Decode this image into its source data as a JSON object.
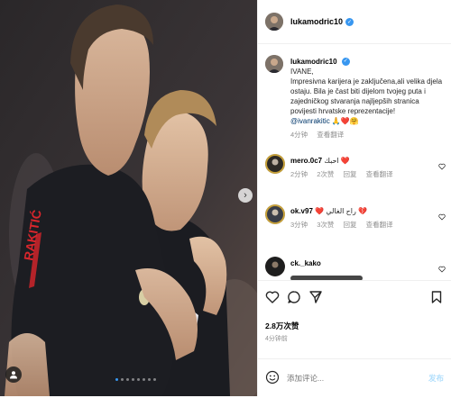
{
  "post": {
    "username": "lukamodric10",
    "verified": true
  },
  "caption": {
    "username": "lukamodric10",
    "text": "IVANE,\nImpresivna karijera je zaključena,ali velika djela ostaju. Bila je čast biti dijelom tvojeg puta i zajedničkog stvaranja najljepših stranica povijesti hrvatske reprezentacije!",
    "mention": "@ivanrakitic",
    "emojis": "🙏❤️🤗",
    "time": "4分钟",
    "translate": "查看翻译"
  },
  "comments": [
    {
      "username": "mero.0c7",
      "text": "احبك ❤️",
      "time": "2分钟",
      "likes": "2次赞",
      "reply": "回复",
      "translate": "查看翻译"
    },
    {
      "username": "ok.v97",
      "text": "❤️ راح الغالي 💔",
      "time": "3分钟",
      "likes": "3次赞",
      "reply": "回复",
      "translate": "查看翻译"
    },
    {
      "username": "ck._kako",
      "text": "",
      "time": "",
      "likes": "",
      "reply": "",
      "translate": ""
    }
  ],
  "stats": {
    "likes": "2.8万次赞",
    "time": "4分钟前"
  },
  "add_comment": {
    "placeholder": "添加评论...",
    "send": "发布"
  },
  "carousel": {
    "current": 1,
    "total": 8
  },
  "icons": {
    "like": "heart-icon",
    "comment": "comment-icon",
    "share": "share-icon",
    "save": "bookmark-icon",
    "emoji": "emoji-icon",
    "next": "chevron-right-icon",
    "tag": "user-tag-icon"
  },
  "colors": {
    "accent": "#3897f0",
    "jersey": "#1c1d22",
    "jersey_accent": "#d9262c"
  }
}
